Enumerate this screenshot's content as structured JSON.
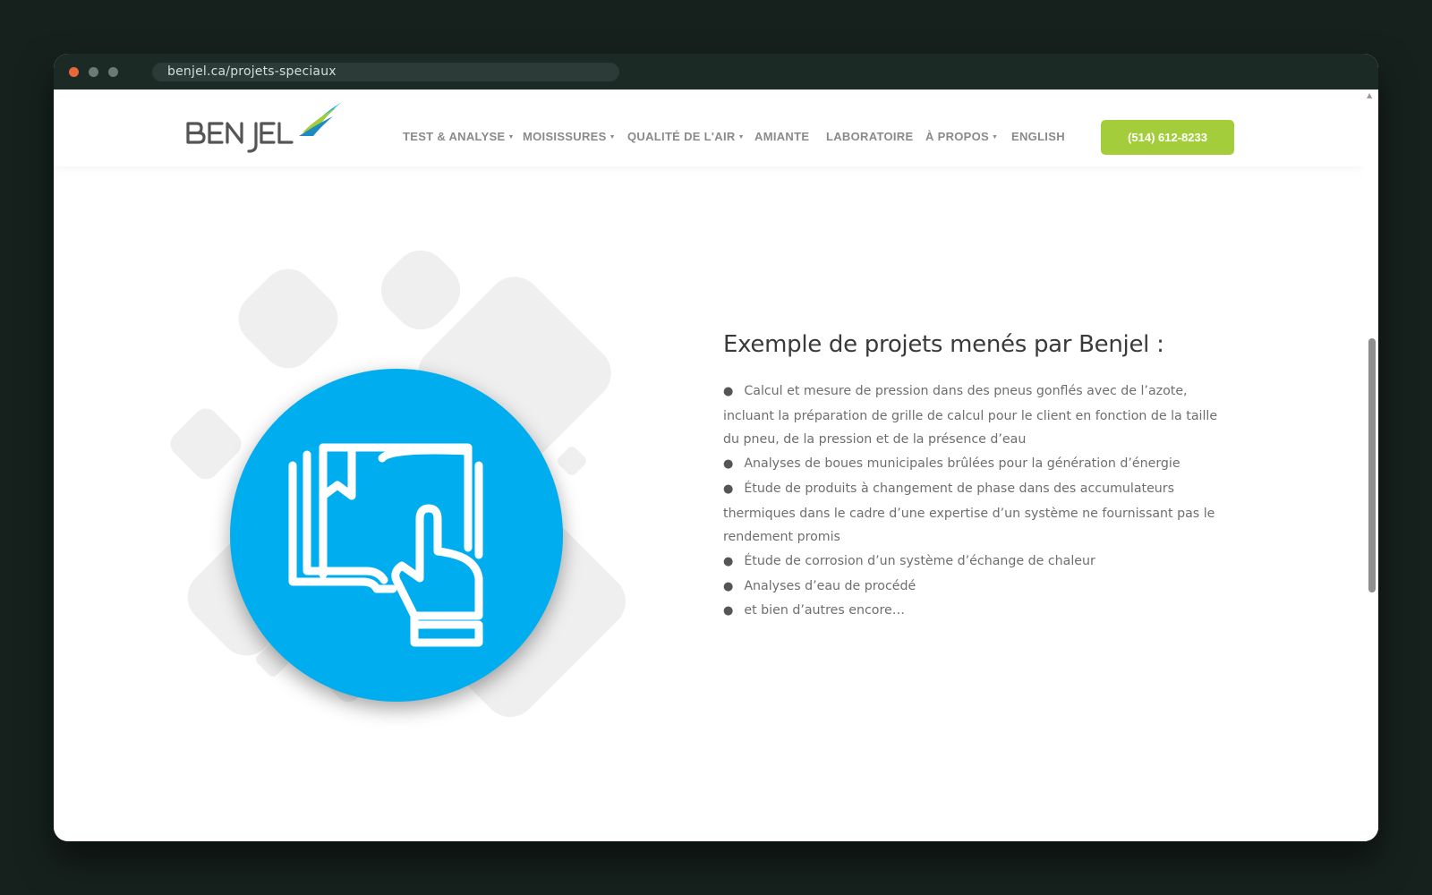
{
  "browser": {
    "url": "benjel.ca/projets-speciaux"
  },
  "brand": {
    "name": "BENJEL",
    "accent": "#00adef",
    "button_color": "#a4cd3b"
  },
  "nav": {
    "items": [
      {
        "label": "TEST & ANALYSE",
        "dropdown": true
      },
      {
        "label": "MOISISSURES",
        "dropdown": true
      },
      {
        "label": "QUALITÉ DE L'AIR",
        "dropdown": true
      },
      {
        "label": "AMIANTE",
        "dropdown": false
      },
      {
        "label": "LABORATOIRE",
        "dropdown": false
      },
      {
        "label": "À PROPOS",
        "dropdown": true
      },
      {
        "label": "ENGLISH",
        "dropdown": false
      }
    ],
    "phone_label": "(514) 612-8233"
  },
  "main": {
    "illustration_icon": "book-hand-pointer-icon",
    "heading": "Exemple de projets menés par Benjel :",
    "items": [
      "Calcul et mesure de pression dans des pneus gonflés avec de l’azote, incluant la préparation de grille de calcul pour le client en fonction de la taille du pneu, de la pression et de la présence d’eau",
      "Analyses de boues municipales brûlées pour la génération d’énergie",
      "Étude de produits à changement de phase dans des accumulateurs thermiques dans le cadre d’une expertise d’un système ne fournissant pas le rendement promis",
      "Étude de corrosion d’un système d’échange de chaleur",
      "Analyses d’eau de procédé",
      "et bien d’autres encore…"
    ]
  }
}
